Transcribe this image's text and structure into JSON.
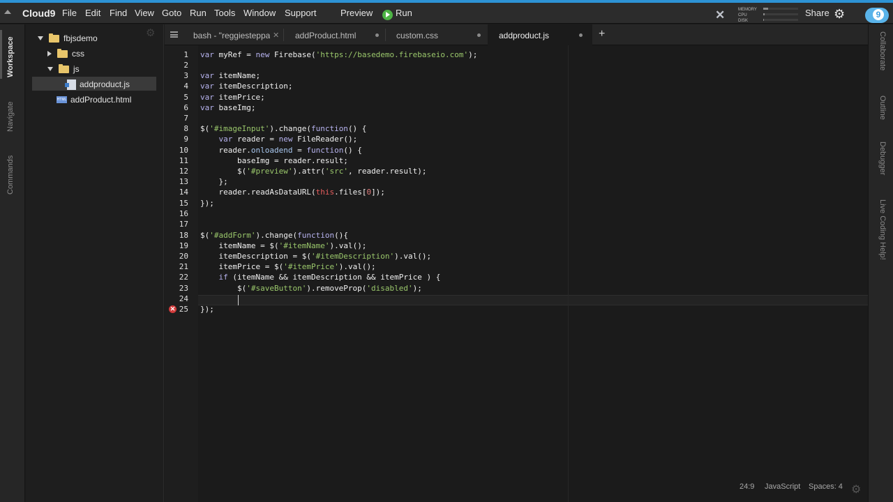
{
  "menubar": {
    "brand": "Cloud9",
    "items": [
      "File",
      "Edit",
      "Find",
      "View",
      "Goto",
      "Run",
      "Tools",
      "Window",
      "Support"
    ],
    "preview": "Preview",
    "run": "Run",
    "meters": [
      "MEMORY",
      "CPU",
      "DISK"
    ],
    "share": "Share",
    "logo_text": "9"
  },
  "left_rail": {
    "tabs": [
      "Workspace",
      "Navigate",
      "Commands"
    ]
  },
  "right_rail": {
    "tabs": [
      "Collaborate",
      "Outline",
      "Debugger",
      "Live Coding Help!"
    ]
  },
  "tree": {
    "root": "fbjsdemo",
    "items": [
      {
        "label": "css",
        "type": "folder",
        "expanded": false
      },
      {
        "label": "js",
        "type": "folder",
        "expanded": true
      },
      {
        "label": "addproduct.js",
        "type": "file-js",
        "selected": true
      },
      {
        "label": "addProduct.html",
        "type": "file-html"
      }
    ],
    "html_icon_text": "HTML"
  },
  "tabs": [
    {
      "label": "bash - \"reggiesteppa",
      "close": "✕"
    },
    {
      "label": "addProduct.html"
    },
    {
      "label": "custom.css"
    },
    {
      "label": "addproduct.js",
      "active": true
    }
  ],
  "editor": {
    "line_numbers": [
      "1",
      "2",
      "3",
      "4",
      "5",
      "6",
      "7",
      "8",
      "9",
      "10",
      "11",
      "12",
      "13",
      "14",
      "15",
      "16",
      "17",
      "18",
      "19",
      "20",
      "21",
      "22",
      "23",
      "24",
      "25"
    ],
    "error_marker": "✕"
  },
  "status": {
    "position": "24:9",
    "mode": "JavaScript",
    "indent": "Spaces: 4"
  }
}
